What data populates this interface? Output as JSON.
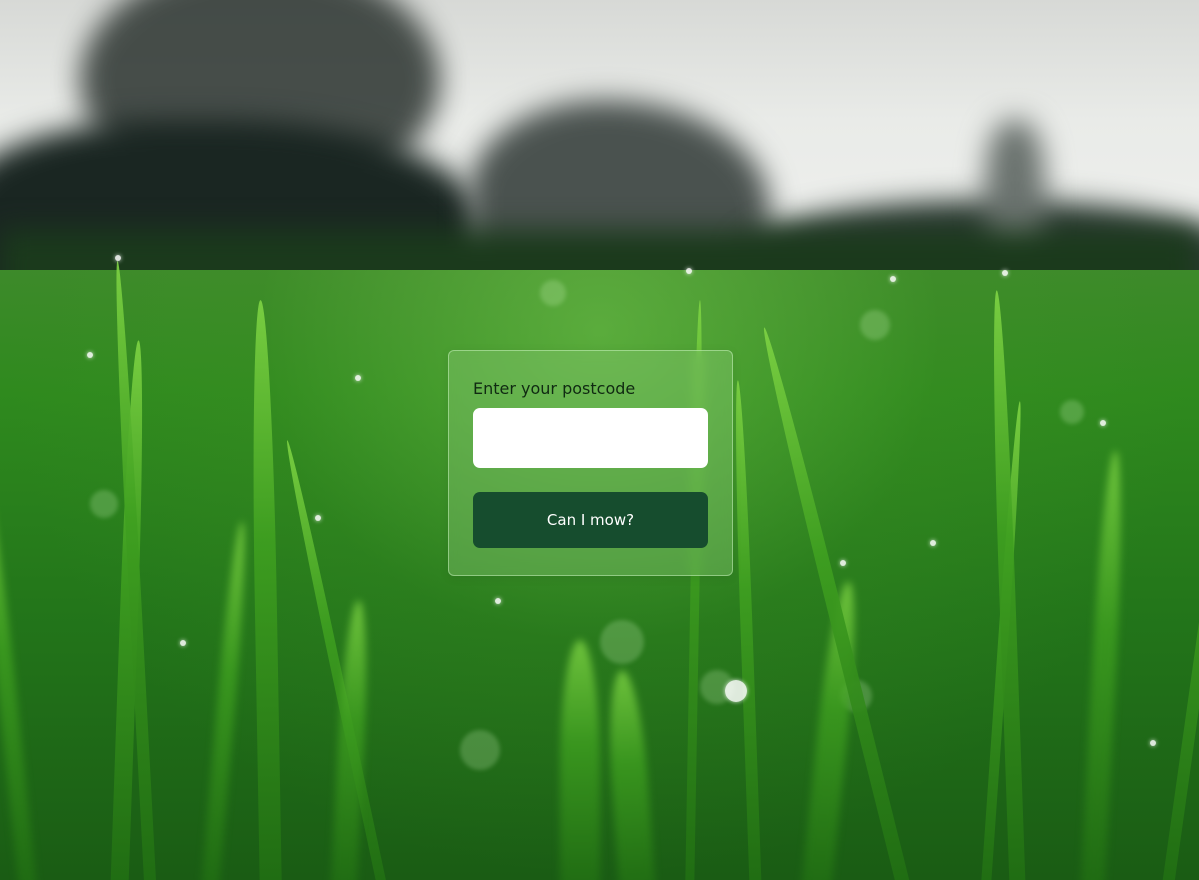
{
  "form": {
    "label": "Enter your postcode",
    "postcode_value": "",
    "postcode_placeholder": "",
    "submit_label": "Can I mow?"
  },
  "colors": {
    "card_tint": "#96d282",
    "button": "#164d2e",
    "input": "#ffffff"
  }
}
